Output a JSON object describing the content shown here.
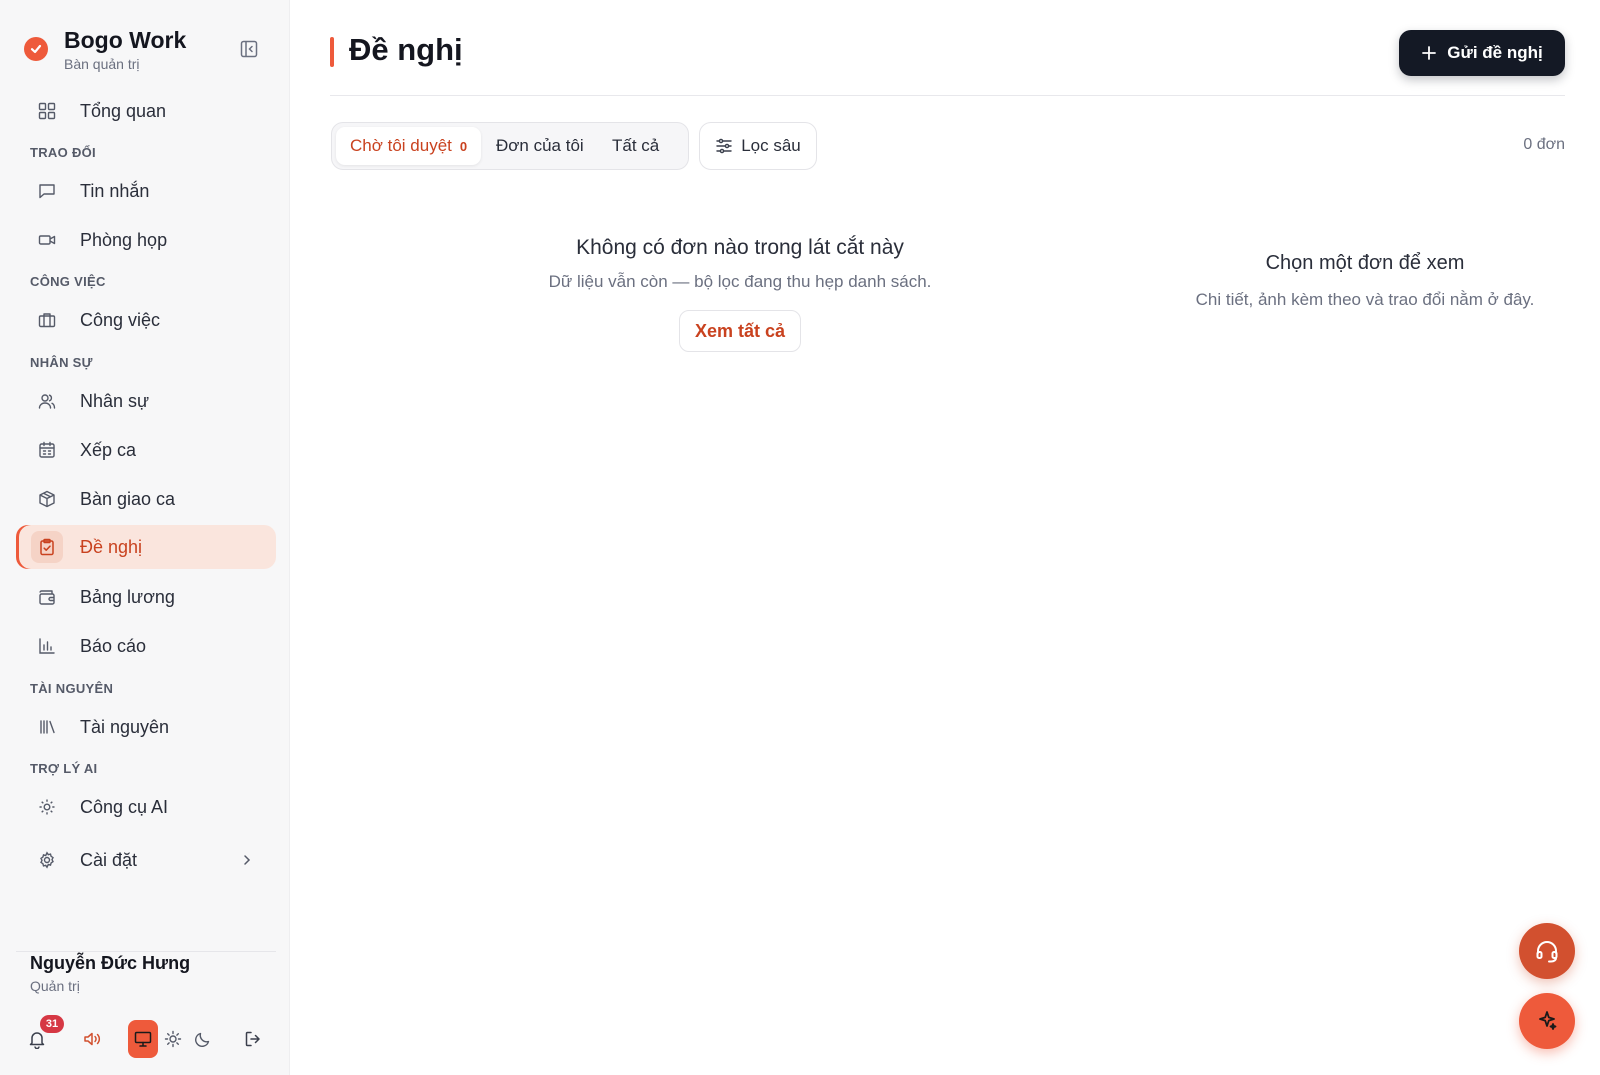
{
  "brand": {
    "name": "Bogo Work",
    "subtitle": "Bàn quản trị"
  },
  "sidebar": {
    "overview": {
      "label": "Tổng quan",
      "icon": "grid-icon"
    },
    "sections": [
      {
        "label": "TRAO ĐỔI"
      },
      {
        "label": "CÔNG VIỆC"
      },
      {
        "label": "NHÂN SỰ"
      },
      {
        "label": "TÀI NGUYÊN"
      },
      {
        "label": "TRỢ LÝ AI"
      }
    ],
    "items": [
      {
        "label": "Tin nhắn",
        "icon": "chat-icon"
      },
      {
        "label": "Phòng họp",
        "icon": "video-icon"
      },
      {
        "label": "Công việc",
        "icon": "briefcase-icon"
      },
      {
        "label": "Nhân sự",
        "icon": "users-icon"
      },
      {
        "label": "Xếp ca",
        "icon": "calendar-icon"
      },
      {
        "label": "Bàn giao ca",
        "icon": "package-icon"
      },
      {
        "label": "Đề nghị",
        "icon": "clipboard-check-icon",
        "active": true
      },
      {
        "label": "Bảng lương",
        "icon": "wallet-icon"
      },
      {
        "label": "Báo cáo",
        "icon": "bar-chart-icon"
      },
      {
        "label": "Tài nguyên",
        "icon": "library-icon"
      },
      {
        "label": "Công cụ AI",
        "icon": "ai-gear-icon"
      },
      {
        "label": "Cài đặt",
        "icon": "settings-icon"
      }
    ]
  },
  "user": {
    "name": "Nguyễn Đức Hưng",
    "role": "Quản trị",
    "notifications": "31"
  },
  "header": {
    "title": "Đề nghị",
    "primary_action": "Gửi đề nghị"
  },
  "tabs": [
    {
      "label": "Chờ tôi duyệt",
      "count": "0",
      "active": true
    },
    {
      "label": "Đơn của tôi"
    },
    {
      "label": "Tất cả"
    }
  ],
  "filter": {
    "label": "Lọc sâu"
  },
  "result_count": "0 đơn",
  "empty_state": {
    "title": "Không có đơn nào trong lát cắt này",
    "subtitle": "Dữ liệu vẫn còn — bộ lọc đang thu hẹp danh sách.",
    "action": "Xem tất cả"
  },
  "detail_placeholder": {
    "title": "Chọn một đơn để xem",
    "subtitle": "Chi tiết, ảnh kèm theo và trao đổi nằm ở đây."
  },
  "colors": {
    "accent": "#ee5a3b",
    "accent_text": "#c9421f",
    "dark": "#141925",
    "active_bg": "#fae5dd"
  }
}
